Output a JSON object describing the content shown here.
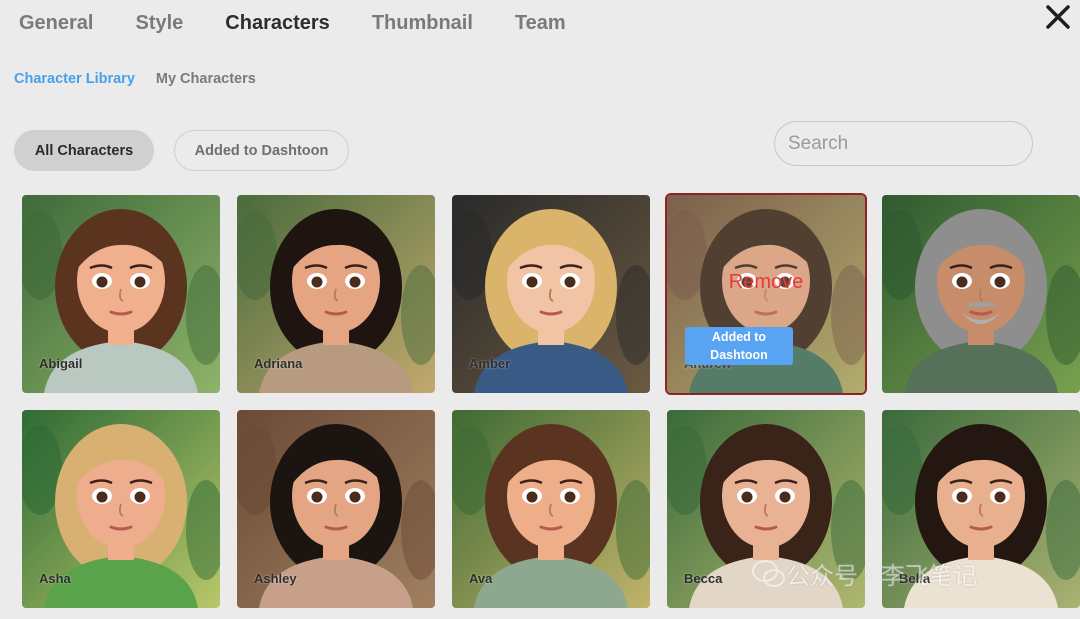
{
  "tabs": [
    {
      "label": "General",
      "active": false
    },
    {
      "label": "Style",
      "active": false
    },
    {
      "label": "Characters",
      "active": true
    },
    {
      "label": "Thumbnail",
      "active": false
    },
    {
      "label": "Team",
      "active": false
    }
  ],
  "close_icon": "close-icon",
  "subtabs": [
    {
      "label": "Character Library",
      "active": true
    },
    {
      "label": "My Characters",
      "active": false
    }
  ],
  "filters": {
    "all": "All Characters",
    "added": "Added to Dashtoon"
  },
  "search": {
    "placeholder": "Search",
    "value": ""
  },
  "colors": {
    "accent": "#4a9fe8",
    "badge": "#58a3f2",
    "remove": "#e53b3b",
    "selected_border": "#8e2323"
  },
  "cards": [
    {
      "name": "Abigail"
    },
    {
      "name": "Adriana"
    },
    {
      "name": "Amber"
    },
    {
      "name": "Andrew",
      "selected": true,
      "remove_label": "Remove",
      "added_label": "Added to Dashtoon"
    },
    {
      "name": ""
    },
    {
      "name": "Asha"
    },
    {
      "name": "Ashley"
    },
    {
      "name": "Ava"
    },
    {
      "name": "Becca"
    },
    {
      "name": "Bella"
    }
  ],
  "watermark": {
    "text": "公众号 · 李飞笔记",
    "icon": "wechat-icon"
  }
}
